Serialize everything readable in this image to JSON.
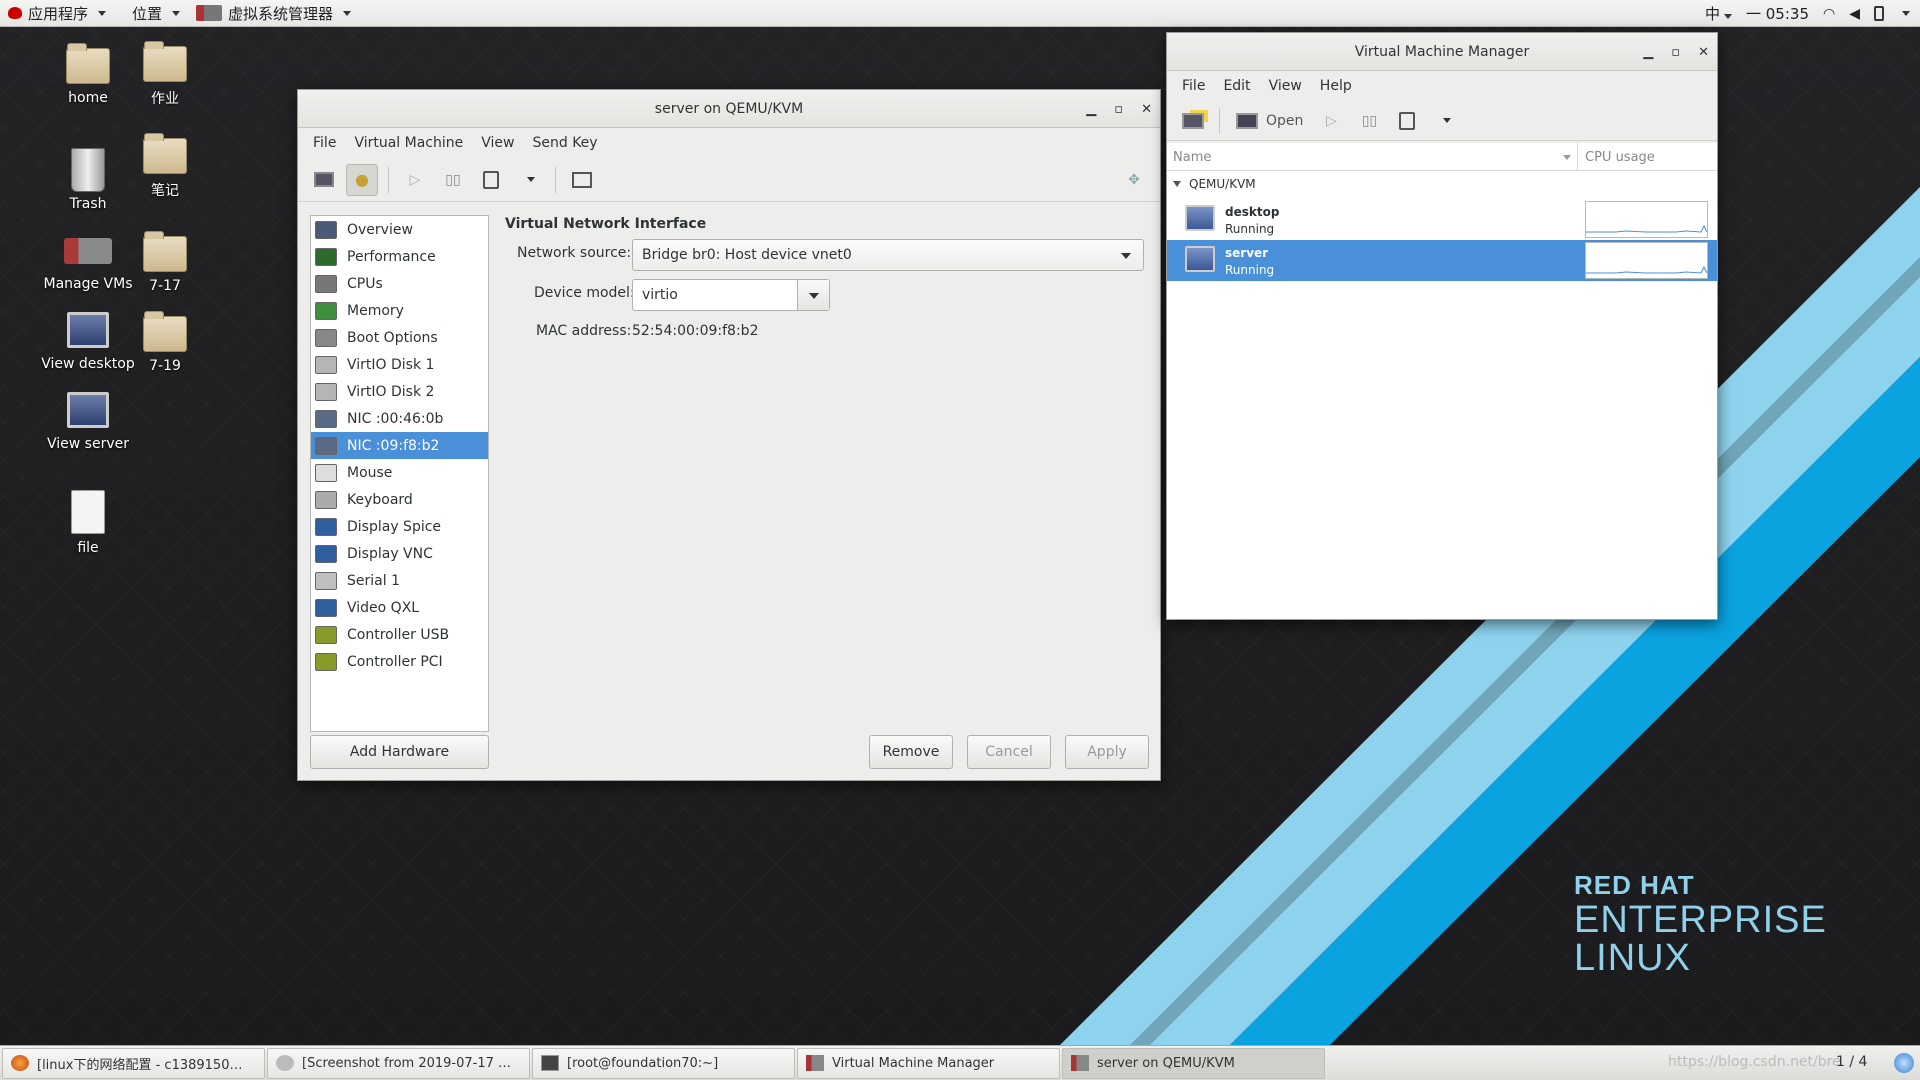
{
  "topbar": {
    "applications": "应用程序",
    "places": "位置",
    "app_name": "虚拟系统管理器",
    "input_method": "中",
    "clock": "一 05:35"
  },
  "desktop_icons": {
    "home": "home",
    "trash": "Trash",
    "manage_vms": "Manage VMs",
    "view_desktop": "View desktop",
    "view_server": "View server",
    "file": "file",
    "folder1": "作业",
    "folder2": "笔记",
    "folder3": "7-17",
    "folder4": "7-19"
  },
  "details_window": {
    "title": "server on QEMU/KVM",
    "menu": [
      "File",
      "Virtual Machine",
      "View",
      "Send Key"
    ],
    "hardware": [
      {
        "label": "Overview",
        "icon": "overview-icon",
        "color": "#4a5a78"
      },
      {
        "label": "Performance",
        "icon": "performance-icon",
        "color": "#2d6b2d"
      },
      {
        "label": "CPUs",
        "icon": "cpu-icon",
        "color": "#777777"
      },
      {
        "label": "Memory",
        "icon": "memory-icon",
        "color": "#3f8f3f"
      },
      {
        "label": "Boot Options",
        "icon": "boot-options-icon",
        "color": "#888888"
      },
      {
        "label": "VirtIO Disk 1",
        "icon": "disk-icon",
        "color": "#b5b5b5"
      },
      {
        "label": "VirtIO Disk 2",
        "icon": "disk-icon",
        "color": "#b5b5b5"
      },
      {
        "label": "NIC :00:46:0b",
        "icon": "nic-icon",
        "color": "#5a6a85"
      },
      {
        "label": "NIC :09:f8:b2",
        "icon": "nic-icon",
        "color": "#5a6a85"
      },
      {
        "label": "Mouse",
        "icon": "mouse-icon",
        "color": "#dddddd"
      },
      {
        "label": "Keyboard",
        "icon": "keyboard-icon",
        "color": "#aaaaaa"
      },
      {
        "label": "Display Spice",
        "icon": "display-icon",
        "color": "#2f5f9f"
      },
      {
        "label": "Display VNC",
        "icon": "display-icon",
        "color": "#2f5f9f"
      },
      {
        "label": "Serial 1",
        "icon": "serial-icon",
        "color": "#c0c0c0"
      },
      {
        "label": "Video QXL",
        "icon": "video-icon",
        "color": "#2f5f9f"
      },
      {
        "label": "Controller USB",
        "icon": "controller-icon",
        "color": "#8a9a2a"
      },
      {
        "label": "Controller PCI",
        "icon": "controller-icon",
        "color": "#8a9a2a"
      }
    ],
    "selected_hardware": "NIC :09:f8:b2",
    "section_title": "Virtual Network Interface",
    "network_source_label": "Network source:",
    "network_source_value": "Bridge br0: Host device vnet0",
    "device_model_label": "Device model:",
    "device_model_value": "virtio",
    "mac_label": "MAC address:",
    "mac_value": "52:54:00:09:f8:b2",
    "add_hardware": "Add Hardware",
    "remove": "Remove",
    "cancel": "Cancel",
    "apply": "Apply"
  },
  "vmm_window": {
    "title": "Virtual Machine Manager",
    "menu": [
      "File",
      "Edit",
      "View",
      "Help"
    ],
    "open_label": "Open",
    "col_name": "Name",
    "col_cpu": "CPU usage",
    "group": "QEMU/KVM",
    "vms": [
      {
        "name": "desktop",
        "status": "Running"
      },
      {
        "name": "server",
        "status": "Running"
      }
    ],
    "selected_vm": "server"
  },
  "branding": {
    "line1": "RED HAT",
    "line2": "ENTERPRISE",
    "line3": "LINUX"
  },
  "taskbar": {
    "tasks": [
      "[linux下的网络配置 - c1389150…",
      "[Screenshot from 2019-07-17 …",
      "[root@foundation70:~]",
      "Virtual Machine Manager",
      "server on QEMU/KVM"
    ],
    "workspace": "1 / 4",
    "watermark": "https://blog.csdn.net/bre"
  },
  "colors": {
    "selection": "#4a90d9",
    "stripe_light": "#7fcbe8",
    "stripe_dark": "#00a0e0"
  }
}
